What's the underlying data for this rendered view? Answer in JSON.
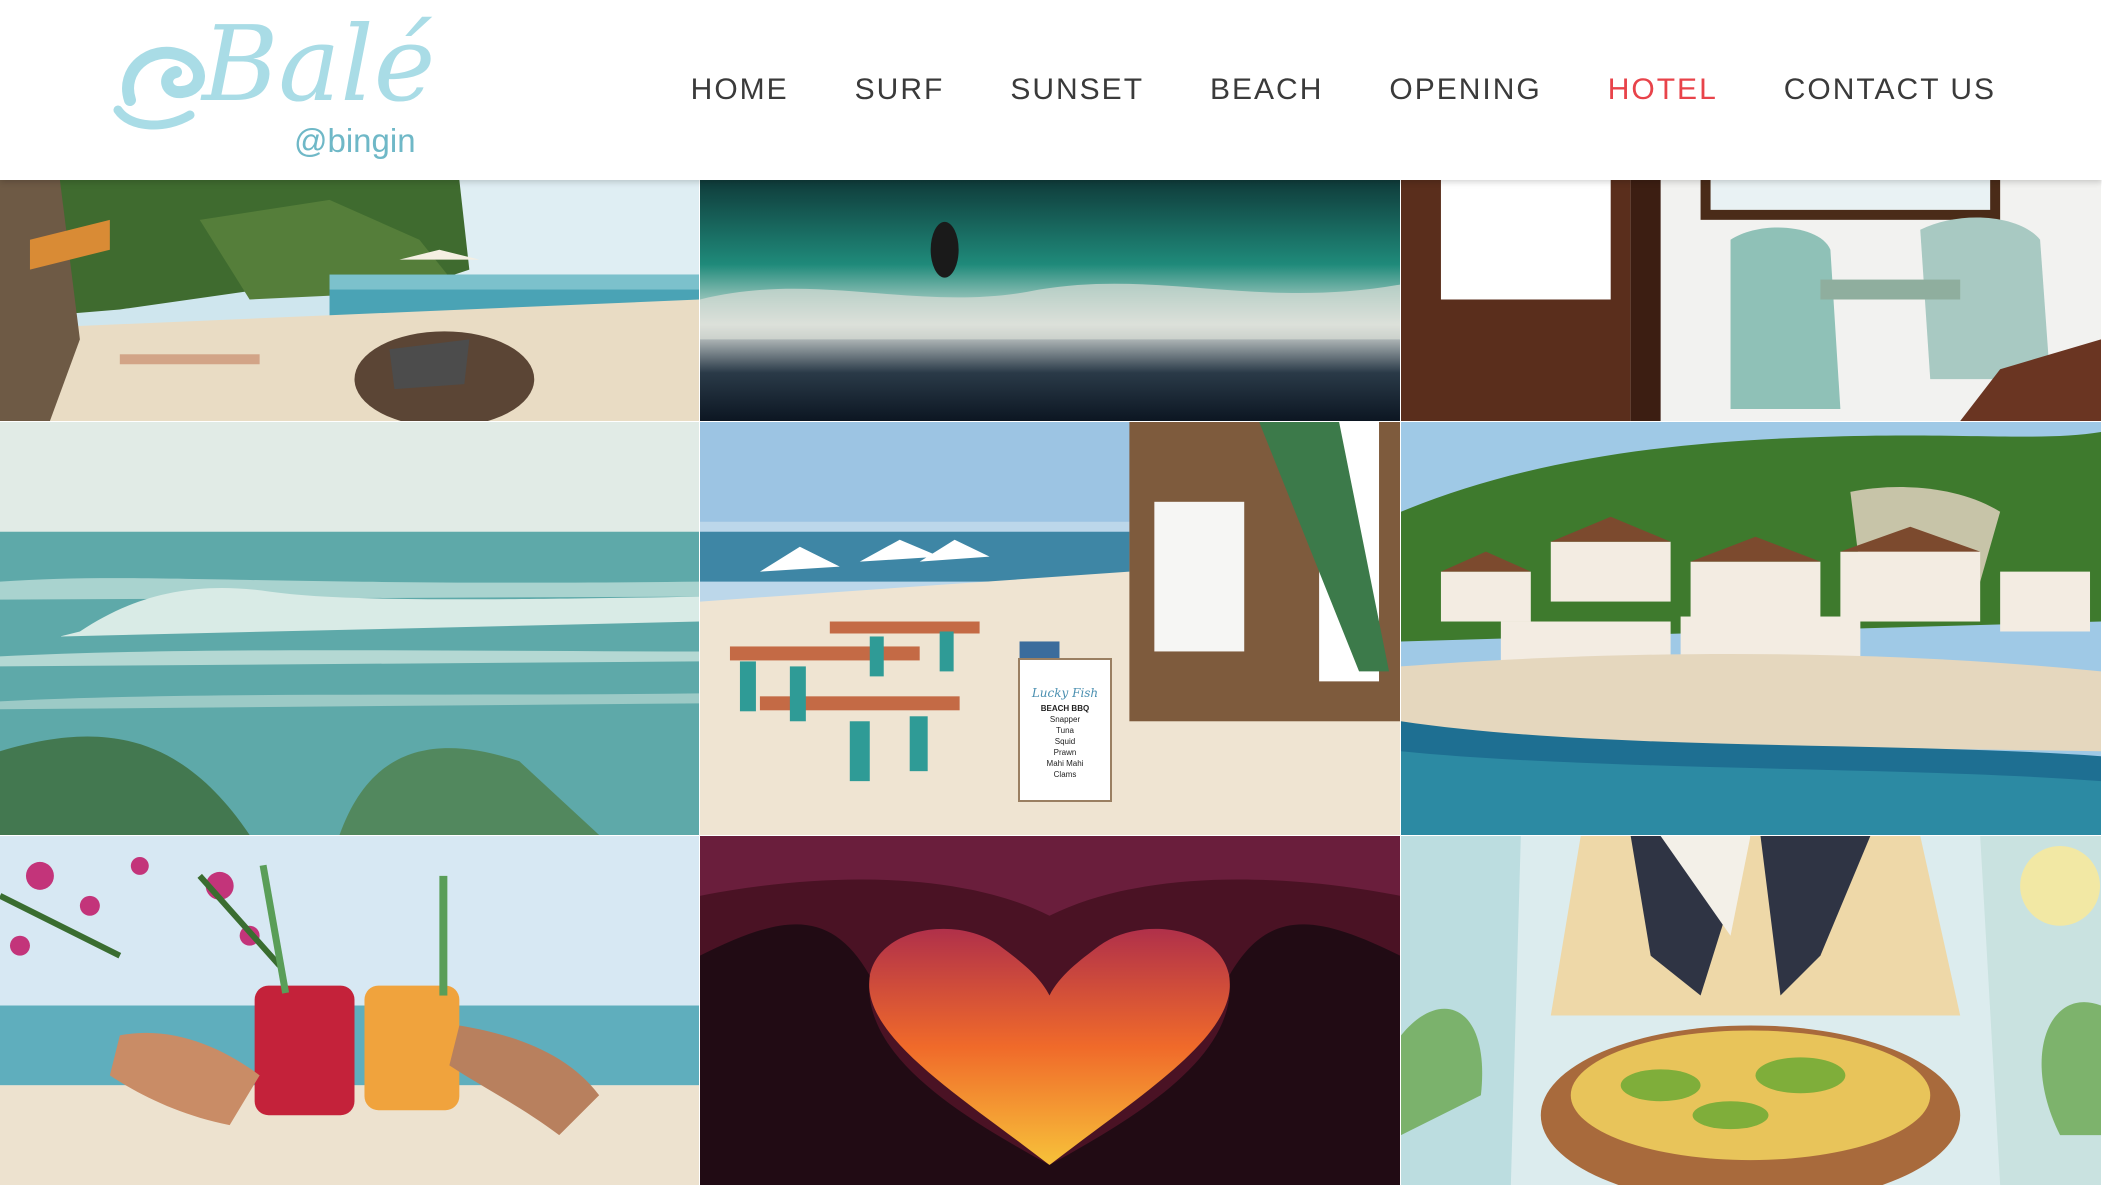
{
  "brand": {
    "wordmark": "Balé",
    "handle": "@bingin",
    "logo_color": "#a9dce6"
  },
  "nav": {
    "items": [
      {
        "label": "HOME",
        "active": false
      },
      {
        "label": "SURF",
        "active": false
      },
      {
        "label": "SUNSET",
        "active": false
      },
      {
        "label": "BEACH",
        "active": false
      },
      {
        "label": "OPENING",
        "active": false
      },
      {
        "label": "HOTEL",
        "active": true
      },
      {
        "label": "CONTACT US",
        "active": false
      }
    ],
    "active_color": "#e8434a",
    "text_color": "#3a3a3a"
  },
  "gallery": {
    "tiles": [
      {
        "name": "beach-rocks-photo"
      },
      {
        "name": "surfer-wave-photo"
      },
      {
        "name": "hotel-room-chairs-photo"
      },
      {
        "name": "ocean-swell-photo"
      },
      {
        "name": "beach-restaurant-photo",
        "sign": {
          "title": "Lucky Fish",
          "subtitle": "BEACH BBQ",
          "items": [
            "Snapper",
            "Tuna",
            "Squid",
            "Prawn",
            "Mahi Mahi",
            "Clams"
          ]
        }
      },
      {
        "name": "cliffside-village-photo"
      },
      {
        "name": "juice-toast-photo"
      },
      {
        "name": "heart-sunset-photo"
      },
      {
        "name": "food-bowl-photo"
      }
    ]
  }
}
